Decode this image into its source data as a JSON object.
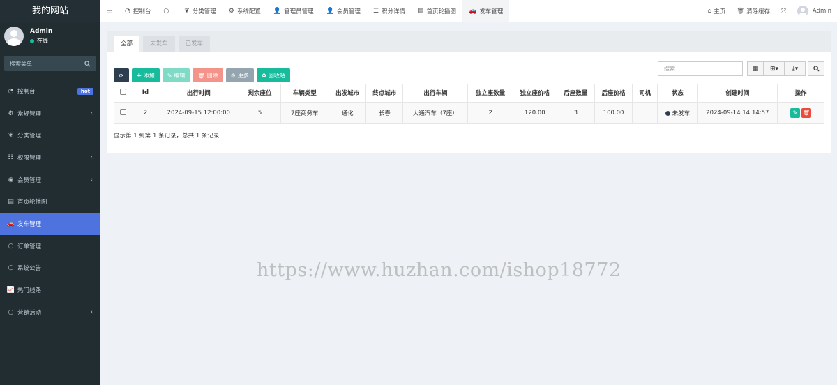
{
  "brand": "我的网站",
  "user": {
    "name": "Admin",
    "status": "在线"
  },
  "sidebar": {
    "search_placeholder": "搜索菜单",
    "items": [
      {
        "label": "控制台",
        "icon": "dashboard-icon",
        "glyph": "◔",
        "badge": "hot"
      },
      {
        "label": "常规管理",
        "icon": "cogs-icon",
        "glyph": "⚙",
        "arrow": "‹"
      },
      {
        "label": "分类管理",
        "icon": "leaf-icon",
        "glyph": "❦"
      },
      {
        "label": "权限管理",
        "icon": "group-icon",
        "glyph": "☷",
        "arrow": "‹"
      },
      {
        "label": "会员管理",
        "icon": "user-circle-icon",
        "glyph": "◉",
        "arrow": "‹"
      },
      {
        "label": "首页轮播图",
        "icon": "film-icon",
        "glyph": "▤"
      },
      {
        "label": "发车管理",
        "icon": "car-icon",
        "glyph": "🚗",
        "active": true
      },
      {
        "label": "订单管理",
        "icon": "circle-icon",
        "glyph": "○"
      },
      {
        "label": "系统公告",
        "icon": "circle-icon",
        "glyph": "○"
      },
      {
        "label": "热门线路",
        "icon": "line-chart-icon",
        "glyph": "📈"
      },
      {
        "label": "营销活动",
        "icon": "circle-icon",
        "glyph": "○",
        "arrow": "‹"
      }
    ]
  },
  "topbar": {
    "tabs": [
      {
        "label": "控制台",
        "icon": "dashboard-icon",
        "glyph": "◔"
      },
      {
        "label": "",
        "icon": "circle-icon",
        "glyph": "○"
      },
      {
        "label": "分类管理",
        "icon": "leaf-icon",
        "glyph": "❦"
      },
      {
        "label": "系统配置",
        "icon": "cog-icon",
        "glyph": "⚙"
      },
      {
        "label": "管理员管理",
        "icon": "user-icon",
        "glyph": "👤"
      },
      {
        "label": "会员管理",
        "icon": "user-icon",
        "glyph": "👤"
      },
      {
        "label": "积分详情",
        "icon": "database-icon",
        "glyph": "☰"
      },
      {
        "label": "首页轮播图",
        "icon": "film-icon",
        "glyph": "▤"
      },
      {
        "label": "发车管理",
        "icon": "car-icon",
        "glyph": "🚗",
        "active": true
      }
    ],
    "home_label": "主页",
    "clear_cache_label": "清除缓存",
    "admin_label": "Admin"
  },
  "content": {
    "tabs": [
      {
        "label": "全部",
        "active": true
      },
      {
        "label": "未发车"
      },
      {
        "label": "已发车"
      }
    ],
    "toolbar": {
      "add": "添加",
      "edit": "编辑",
      "delete": "删除",
      "more": "更多",
      "recycle": "回收站",
      "search_placeholder": "搜索"
    },
    "table": {
      "columns": [
        "Id",
        "出行时间",
        "剩余座位",
        "车辆类型",
        "出发城市",
        "终点城市",
        "出行车辆",
        "独立座数量",
        "独立座价格",
        "后座数量",
        "后座价格",
        "司机",
        "状态",
        "创建时间",
        "操作"
      ],
      "rows": [
        [
          "2",
          "2024-09-15 12:00:00",
          "5",
          "7座商务车",
          "通化",
          "长春",
          "大通汽车（7座）",
          "2",
          "120.00",
          "3",
          "100.00",
          "",
          "未发车",
          "2024-09-14 14:14:57"
        ]
      ]
    },
    "pager_text": "显示第 1 到第 1 条记录，总共 1 条记录"
  },
  "watermark": "https://www.huzhan.com/ishop18772",
  "colors": {
    "sidebar_bg": "#222d32",
    "active_menu": "#4e73df",
    "success": "#18bc9c",
    "danger": "#e74c3c"
  }
}
